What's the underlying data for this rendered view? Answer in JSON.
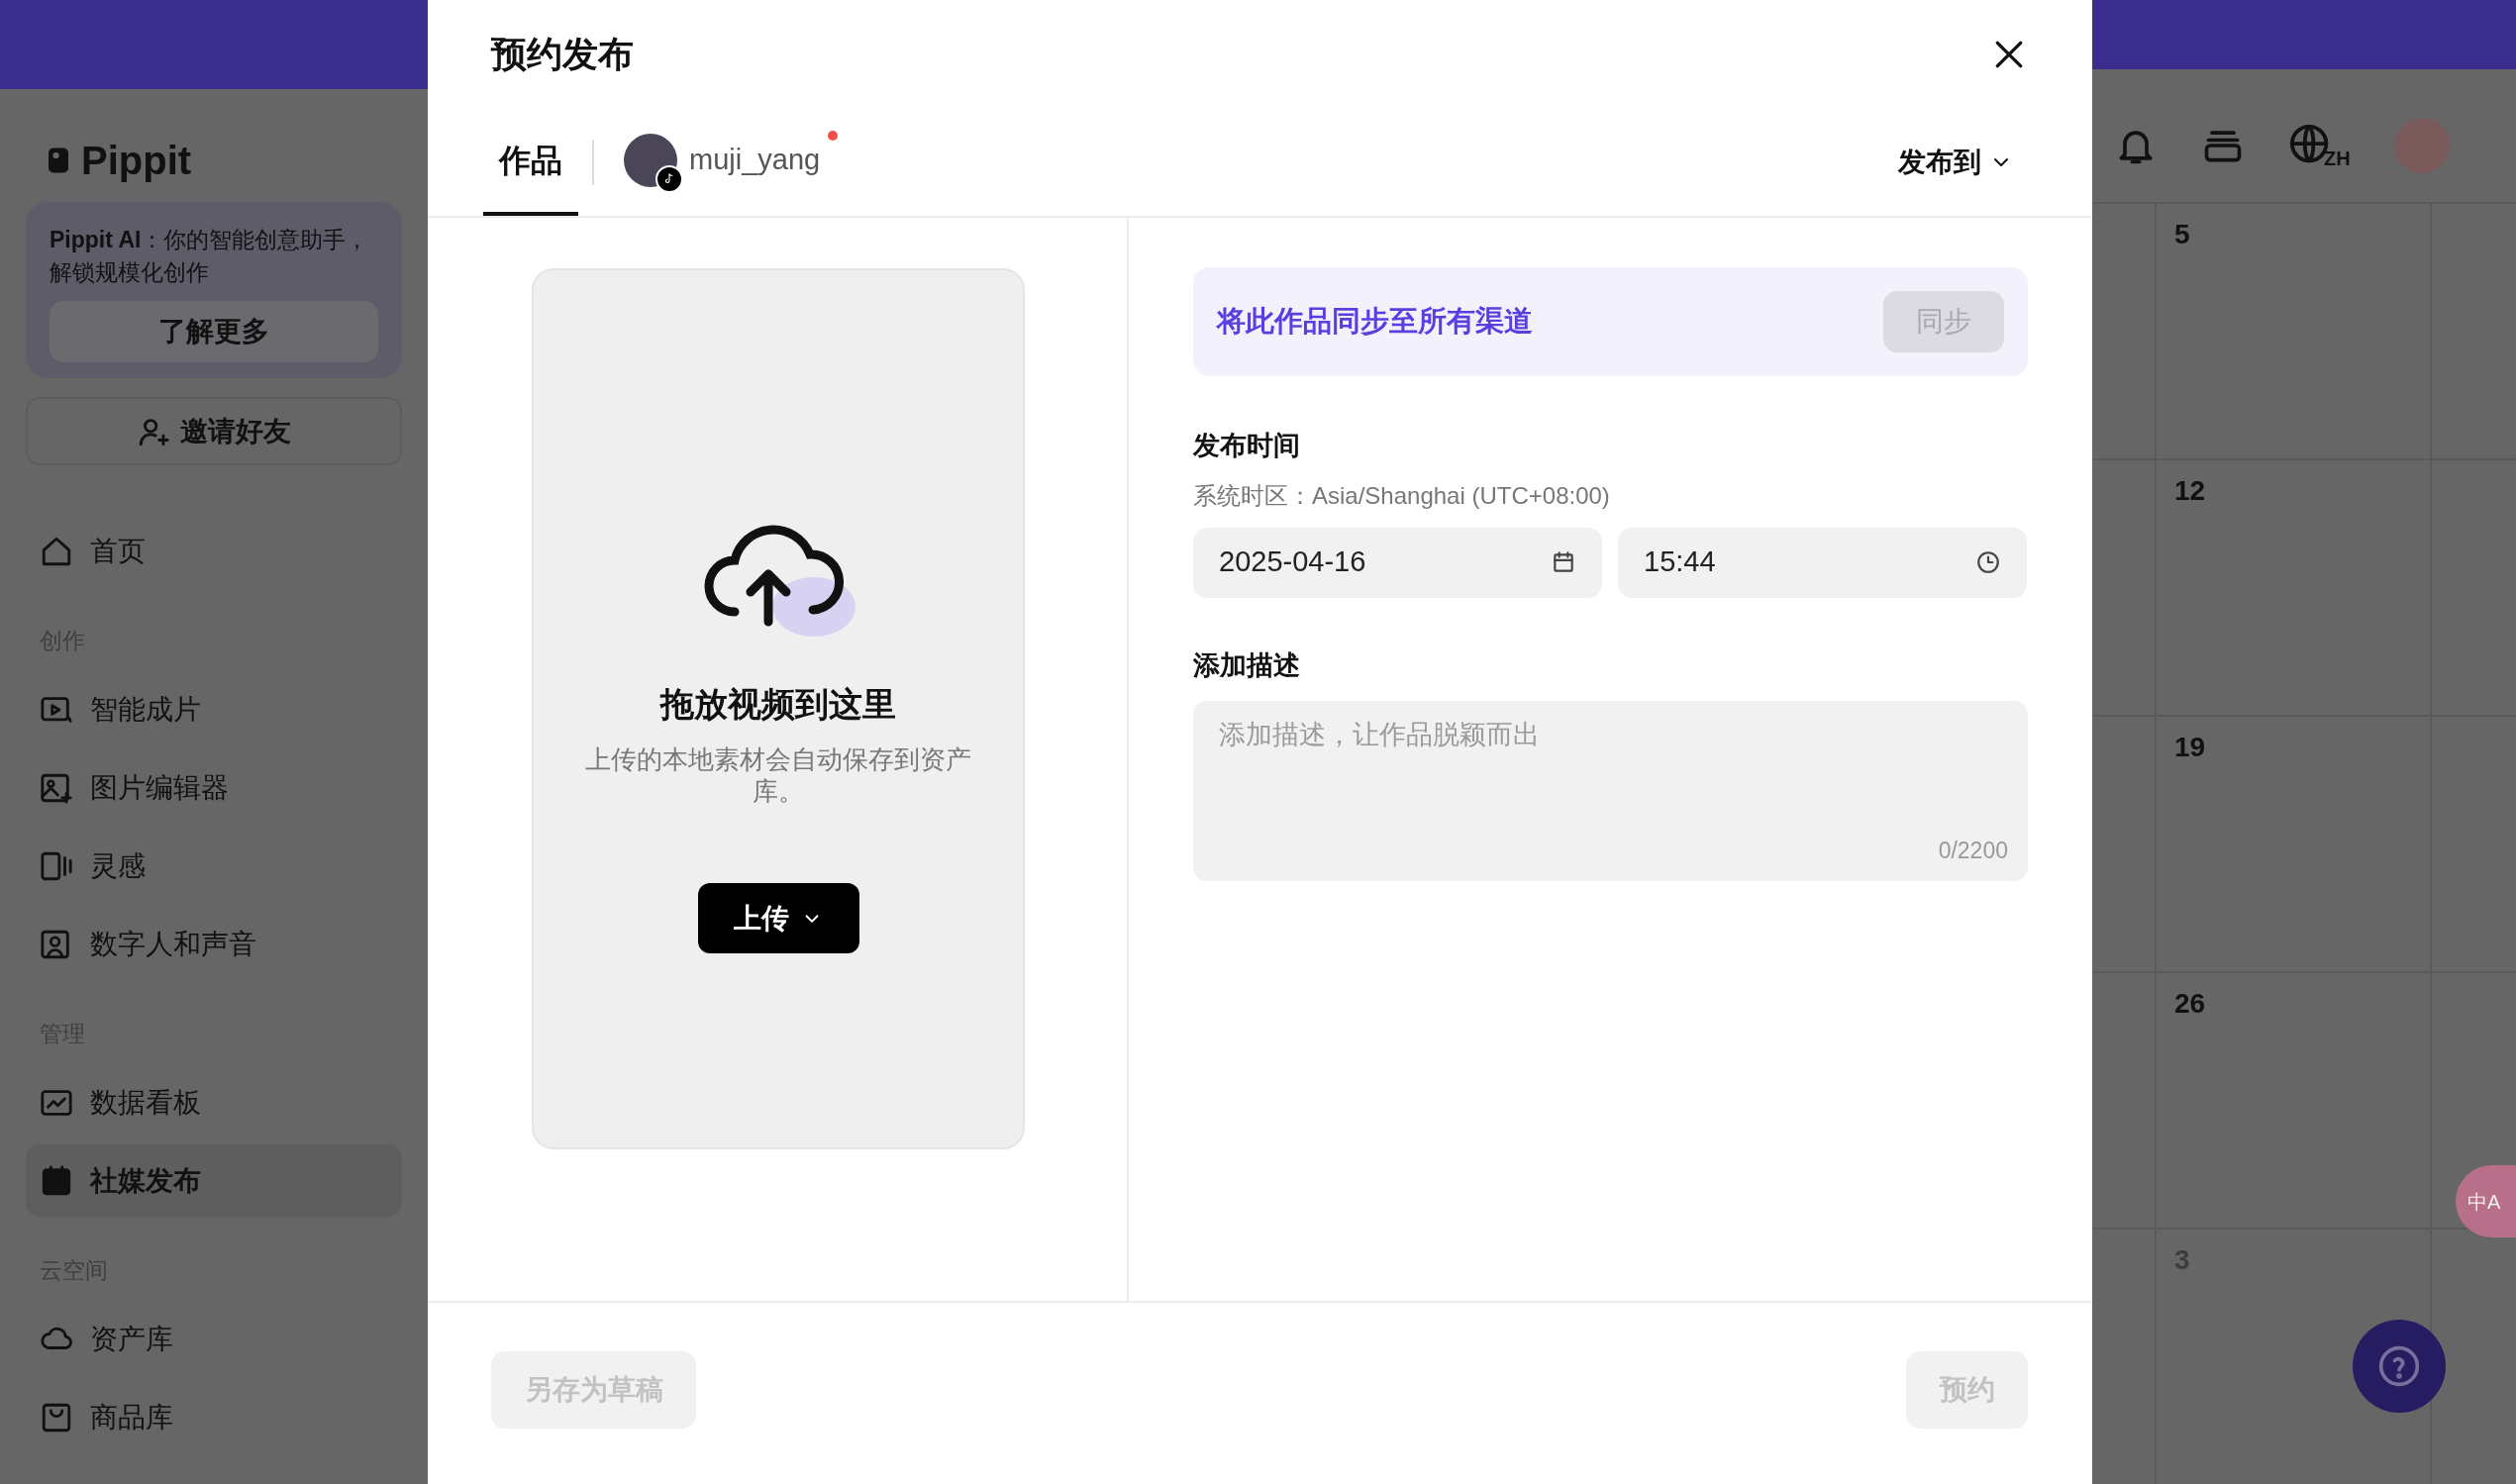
{
  "sidebar": {
    "logo": "Pippit",
    "promo": {
      "text": "**Pippit AI**：你的智能创意助手，解锁规模化创作",
      "button": "了解更多"
    },
    "invite_button": "邀请好友",
    "groups": [
      {
        "items": [
          {
            "label": "首页",
            "selected": false
          }
        ]
      },
      {
        "title": "创作",
        "items": [
          {
            "label": "智能成片",
            "selected": false
          },
          {
            "label": "图片编辑器",
            "selected": false
          },
          {
            "label": "灵感",
            "selected": false
          },
          {
            "label": "数字人和声音",
            "selected": false
          }
        ]
      },
      {
        "title": "管理",
        "items": [
          {
            "label": "数据看板",
            "selected": false
          },
          {
            "label": "社媒发布",
            "selected": true
          }
        ]
      },
      {
        "title": "云空间",
        "items": [
          {
            "label": "资产库",
            "selected": false
          },
          {
            "label": "商品库",
            "selected": false
          }
        ]
      }
    ]
  },
  "header": {
    "language": "ZH"
  },
  "calendar": {
    "days": [
      {
        "label": "5",
        "other_month": false
      },
      {
        "label": "12",
        "other_month": false
      },
      {
        "label": "19",
        "other_month": false
      },
      {
        "label": "26",
        "other_month": false
      },
      {
        "label": "3",
        "other_month": true
      }
    ]
  },
  "translate_button": "中A",
  "modal": {
    "title": "预约发布",
    "tabs": [
      {
        "kind": "works",
        "label": "作品",
        "selected": true
      },
      {
        "kind": "account",
        "label": "muji_yang",
        "selected": false,
        "unread": true
      }
    ],
    "publish_to": "发布到",
    "upload": {
      "title": "拖放视频到这里",
      "hint": "上传的本地素材会自动保存到资产库。",
      "button": "上传"
    },
    "sync": {
      "text": "将此作品同步至所有渠道",
      "button": "同步",
      "disabled": true
    },
    "publish_time": {
      "label": "发布时间",
      "timezone": "系统时区：Asia/Shanghai (UTC+08:00)",
      "date": "2025-04-16",
      "time": "15:44"
    },
    "description": {
      "label": "添加描述",
      "placeholder": "添加描述，让作品脱颖而出",
      "counter": "0/2200"
    },
    "footer": {
      "draft_button": {
        "label": "另存为草稿",
        "disabled": true
      },
      "schedule_button": {
        "label": "预约",
        "disabled": true
      }
    }
  }
}
